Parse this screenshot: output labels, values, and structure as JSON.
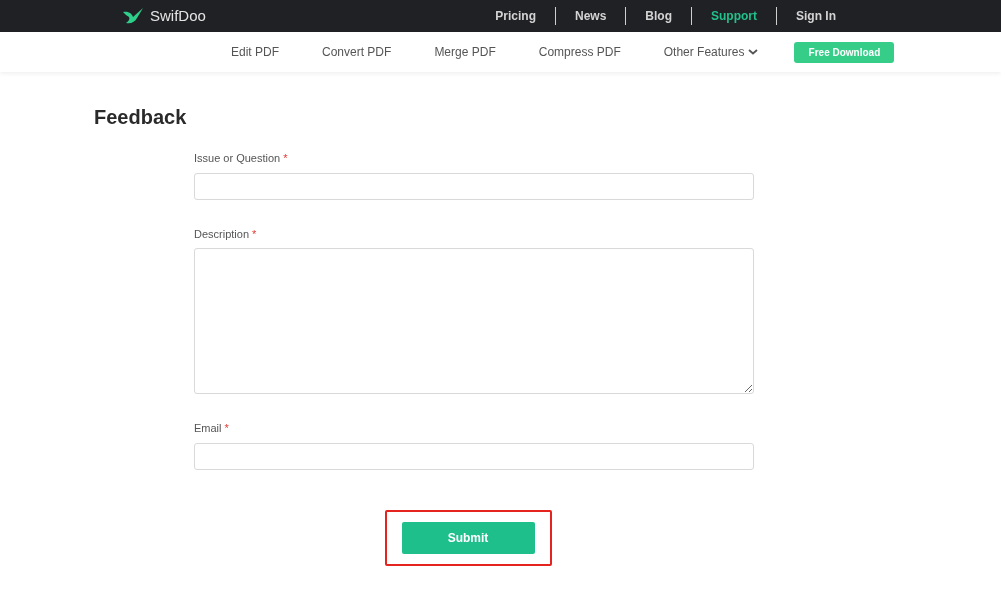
{
  "brand": {
    "name": "SwifDoo"
  },
  "top_nav": [
    {
      "label": "Pricing",
      "selected": false
    },
    {
      "label": "News",
      "selected": false
    },
    {
      "label": "Blog",
      "selected": false
    },
    {
      "label": "Support",
      "selected": true
    },
    {
      "label": "Sign In",
      "selected": false
    }
  ],
  "sub_nav": [
    {
      "label": "Edit PDF",
      "kind": "link"
    },
    {
      "label": "Convert PDF",
      "kind": "link"
    },
    {
      "label": "Merge PDF",
      "kind": "link"
    },
    {
      "label": "Compress PDF",
      "kind": "link"
    },
    {
      "label": "Other Features",
      "kind": "dropdown"
    }
  ],
  "download_button": "Free Download",
  "page_title": "Feedback",
  "form": {
    "fields": [
      {
        "label": "Issue or Question",
        "required_mark": "*",
        "kind": "input"
      },
      {
        "label": "Description",
        "required_mark": "*",
        "kind": "textarea"
      },
      {
        "label": "Email",
        "required_mark": "*",
        "kind": "input"
      }
    ],
    "submit": {
      "label": "Submit",
      "highlighted": true
    }
  }
}
